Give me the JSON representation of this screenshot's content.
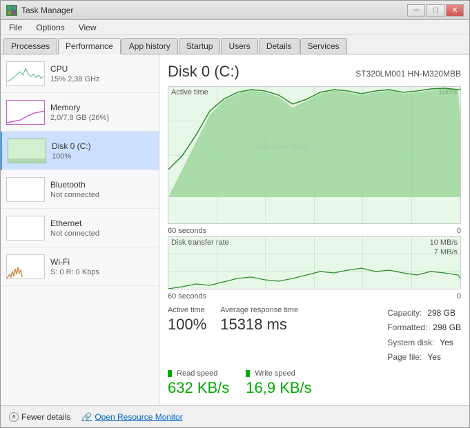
{
  "window": {
    "title": "Task Manager",
    "icon": "TM"
  },
  "titlebar": {
    "minimize": "─",
    "maximize": "□",
    "close": "✕"
  },
  "menu": {
    "items": [
      "File",
      "Options",
      "View"
    ]
  },
  "tabs": [
    {
      "id": "processes",
      "label": "Processes"
    },
    {
      "id": "performance",
      "label": "Performance"
    },
    {
      "id": "app-history",
      "label": "App history"
    },
    {
      "id": "startup",
      "label": "Startup"
    },
    {
      "id": "users",
      "label": "Users"
    },
    {
      "id": "details",
      "label": "Details"
    },
    {
      "id": "services",
      "label": "Services"
    }
  ],
  "sidebar": {
    "items": [
      {
        "id": "cpu",
        "label": "CPU",
        "sub": "15% 2,38 GHz",
        "type": "cpu"
      },
      {
        "id": "memory",
        "label": "Memory",
        "sub": "2,0/7,8 GB (26%)",
        "type": "memory"
      },
      {
        "id": "disk",
        "label": "Disk 0 (C:)",
        "sub": "100%",
        "type": "disk",
        "active": true
      },
      {
        "id": "bluetooth",
        "label": "Bluetooth",
        "sub": "Not connected",
        "type": "bluetooth"
      },
      {
        "id": "ethernet",
        "label": "Ethernet",
        "sub": "Not connected",
        "type": "ethernet"
      },
      {
        "id": "wifi",
        "label": "Wi-Fi",
        "sub": "S: 0 R: 0 Kbps",
        "type": "wifi"
      }
    ]
  },
  "main": {
    "disk_title": "Disk 0 (C:)",
    "disk_model": "ST320LM001 HN-M320MBB",
    "chart1": {
      "label": "Active time",
      "percent": "100%",
      "time_label": "60 seconds",
      "time_right": "0"
    },
    "chart2": {
      "label": "Disk transfer rate",
      "right1": "10 MB/s",
      "right2": "7 MB/s",
      "time_label": "60 seconds",
      "time_right": "0"
    },
    "stats": {
      "active_time_label": "Active time",
      "active_time_value": "100%",
      "response_time_label": "Average response time",
      "response_time_value": "15318 ms",
      "read_speed_label": "Read speed",
      "read_speed_value": "632 KB/s",
      "write_speed_label": "Write speed",
      "write_speed_value": "16,9 KB/s",
      "capacity_label": "Capacity:",
      "capacity_value": "298 GB",
      "formatted_label": "Formatted:",
      "formatted_value": "298 GB",
      "system_disk_label": "System disk:",
      "system_disk_value": "Yes",
      "page_file_label": "Page file:",
      "page_file_value": "Yes"
    }
  },
  "footer": {
    "fewer_details": "Fewer details",
    "open_resource_monitor": "Open Resource Monitor"
  }
}
